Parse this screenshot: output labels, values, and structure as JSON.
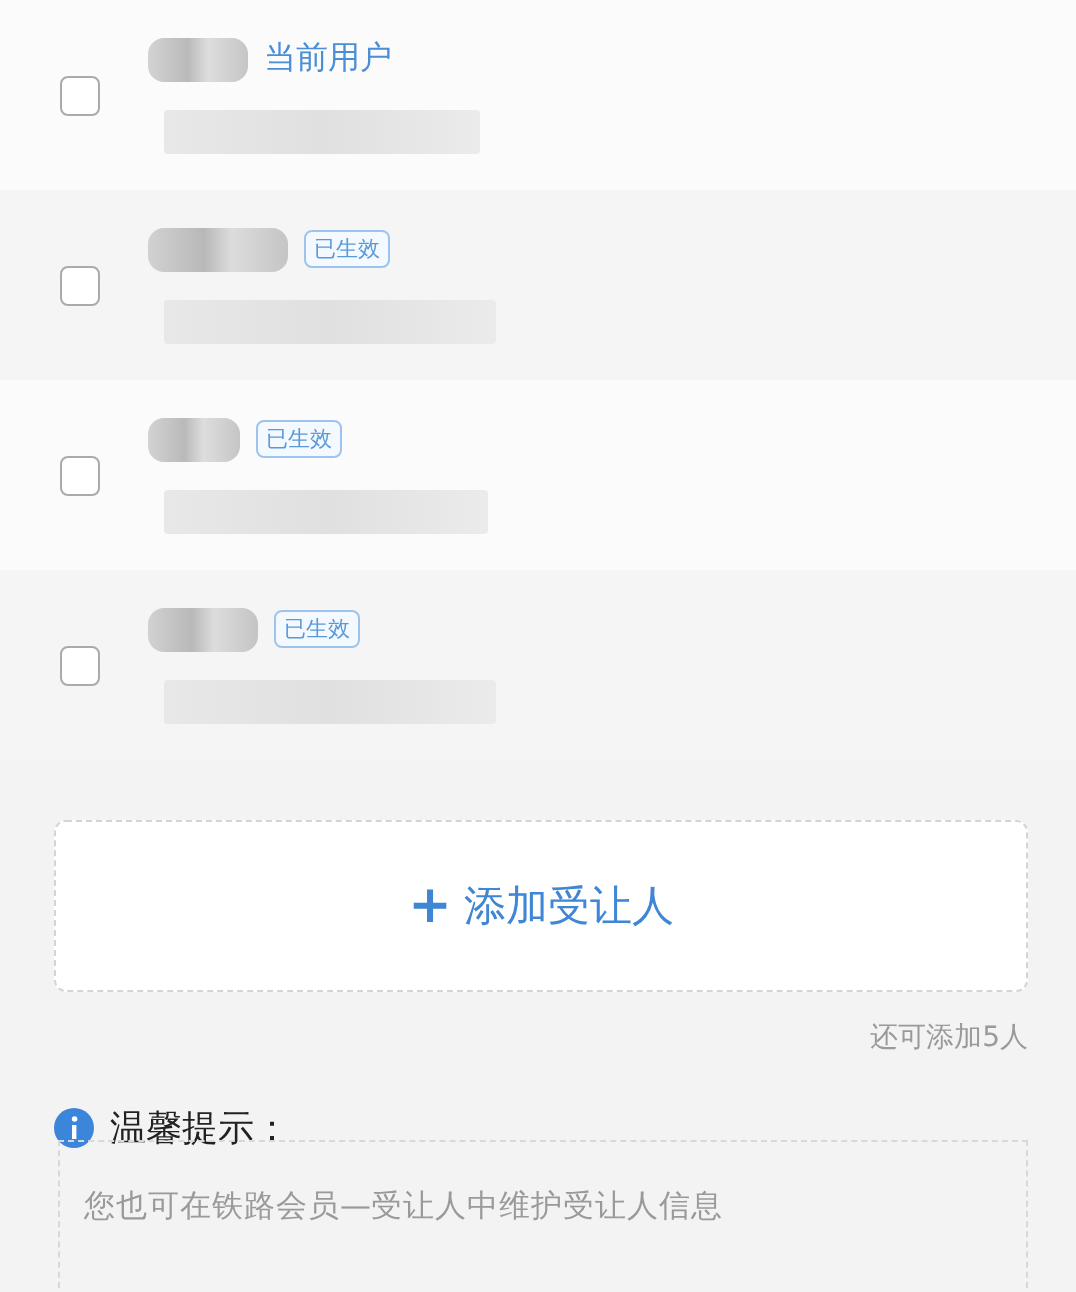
{
  "users": [
    {
      "tag": "当前用户",
      "kind": "current",
      "checked": false
    },
    {
      "tag": "已生效",
      "kind": "active",
      "checked": false
    },
    {
      "tag": "已生效",
      "kind": "active",
      "checked": false
    },
    {
      "tag": "已生效",
      "kind": "active",
      "checked": false
    }
  ],
  "add_button": {
    "icon": "+",
    "label": "添加受让人"
  },
  "remaining": "还可添加5人",
  "tip": {
    "title": "温馨提示：",
    "text": "您也可在铁路会员—受让人中维护受让人信息"
  }
}
